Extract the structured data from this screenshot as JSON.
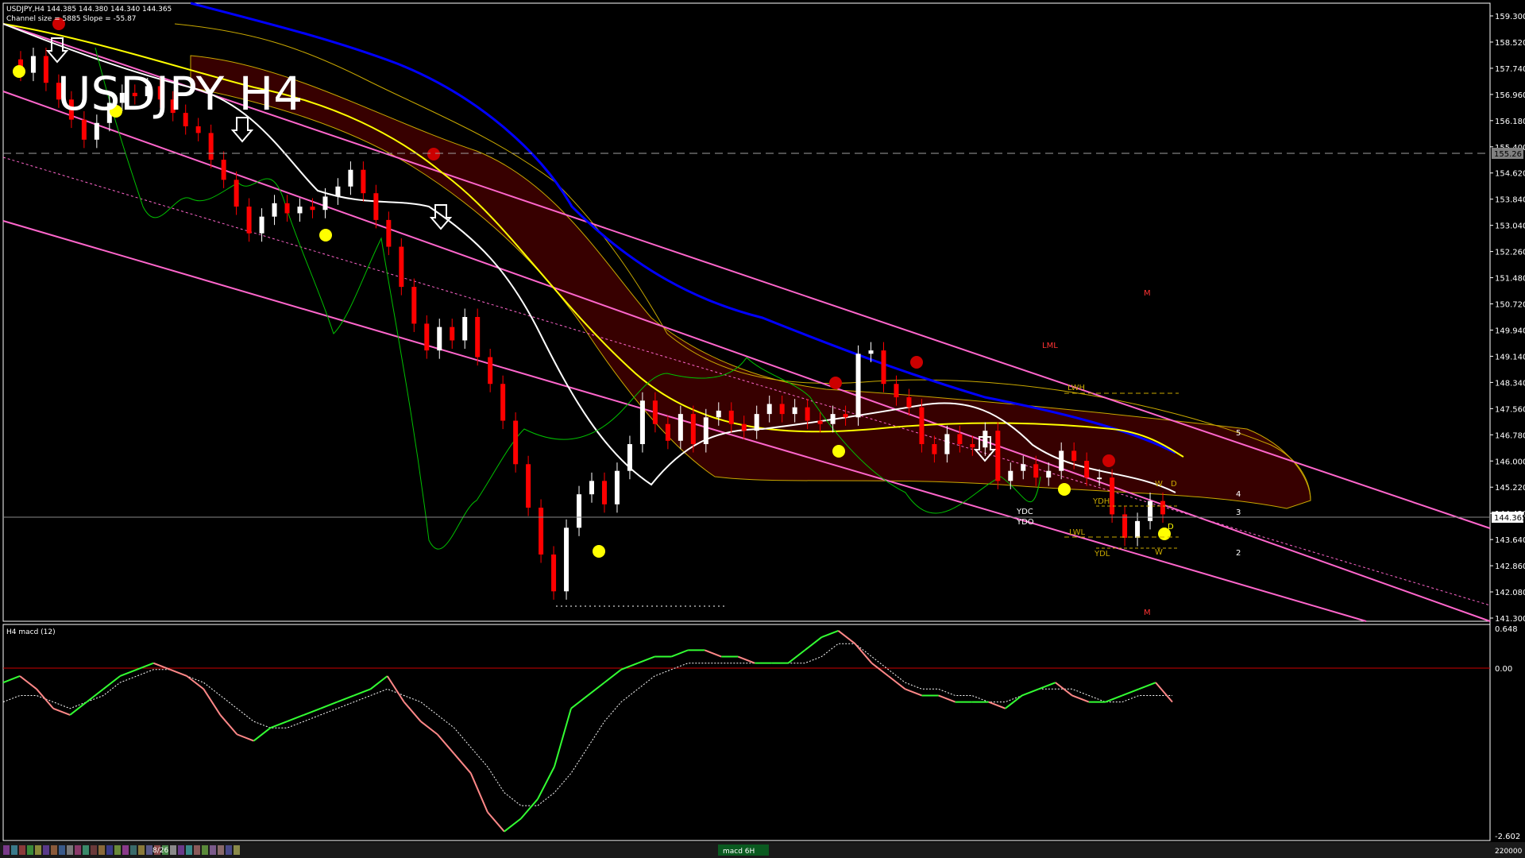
{
  "header": {
    "symbol_info": "USDJPY,H4  144.385 144.380 144.340 144.365",
    "channel_info": "Channel size = 5885 Slope = -55.87",
    "big_title": "USDJPY H4"
  },
  "sub_panel": {
    "label": "H4  macd (12)",
    "axis_labels": [
      "0.648",
      "0.00",
      "-2.602"
    ]
  },
  "price_axis": {
    "labels": [
      "159.300",
      "158.520",
      "157.740",
      "156.960",
      "156.180",
      "155.400",
      "154.620",
      "153.840",
      "153.040",
      "152.260",
      "151.480",
      "150.720",
      "149.940",
      "149.140",
      "148.340",
      "147.560",
      "146.780",
      "146.000",
      "145.220",
      "144.420",
      "143.640",
      "142.860",
      "142.080",
      "141.300"
    ],
    "current_price": "144.365",
    "dashed_level_label": "155.26",
    "macd_volume_label": "220000"
  },
  "level_labels": {
    "lwh": "LWH",
    "lml": "LML",
    "lwl": "LWL",
    "ydh": "YDH",
    "ydl": "YDL",
    "ydc": "YDC",
    "ydo": "YDO",
    "m_top": "M",
    "m_bottom": "M",
    "w_top": "W",
    "d_top": "D",
    "w_bottom": "W",
    "d_bottom": "D",
    "n5": "5",
    "n4": "4",
    "n3": "3",
    "n2": "2"
  },
  "bottom_bar": {
    "date_label": "8/26",
    "tab_label": "macd 6H"
  },
  "colors": {
    "bull_candle": "#ffffff",
    "bear_candle": "#ff0000",
    "ma_blue": "#0000ff",
    "ma_yellow": "#ffff00",
    "ma_white": "#ffffff",
    "channel": "#ff66cc",
    "chikou": "#00c000",
    "cloud_edge": "#c8a800",
    "macd_main_up": "#33ff33",
    "macd_main_down": "#ff8888",
    "signal": "#ffffff"
  },
  "chart_data": [
    {
      "type": "line",
      "title": "USDJPY H4",
      "ylim": [
        141.3,
        159.3
      ],
      "series": [
        {
          "name": "price",
          "values": [
            158.0,
            157.6,
            158.1,
            157.3,
            156.8,
            156.2,
            155.6,
            156.1,
            156.7,
            157.0,
            156.9,
            157.2,
            156.8,
            156.4,
            156.0,
            155.8,
            155.0,
            154.4,
            153.6,
            152.8,
            153.3,
            153.7,
            153.4,
            153.6,
            153.5,
            153.9,
            154.2,
            154.7,
            154.0,
            153.2,
            152.4,
            151.2,
            150.1,
            149.3,
            150.0,
            149.6,
            150.3,
            149.1,
            148.3,
            147.2,
            145.9,
            144.6,
            143.2,
            142.1,
            144.0,
            145.0,
            145.4,
            144.7,
            145.7,
            146.5,
            147.8,
            147.1,
            146.6,
            147.4,
            146.5,
            147.3,
            147.5,
            147.1,
            146.9,
            147.4,
            147.7,
            147.4,
            147.6,
            147.2,
            147.1,
            147.4,
            147.3,
            149.2,
            149.3,
            148.3,
            147.9,
            147.6,
            146.5,
            146.2,
            146.8,
            146.5,
            146.4,
            146.9,
            145.4,
            145.7,
            145.9,
            145.5,
            145.7,
            146.3,
            146.0,
            145.5,
            145.5,
            144.4,
            143.7,
            144.2,
            144.8,
            144.4
          ]
        }
      ]
    },
    {
      "type": "line",
      "title": "H4 macd (12)",
      "ylim": [
        -2.602,
        0.648
      ],
      "series": [
        {
          "name": "macd",
          "values": [
            -0.2,
            -0.1,
            -0.3,
            -0.6,
            -0.7,
            -0.5,
            -0.3,
            -0.1,
            0.0,
            0.1,
            0.0,
            -0.1,
            -0.3,
            -0.7,
            -1.0,
            -1.1,
            -0.9,
            -0.8,
            -0.7,
            -0.6,
            -0.5,
            -0.4,
            -0.3,
            -0.1,
            -0.5,
            -0.8,
            -1.0,
            -1.3,
            -1.6,
            -2.2,
            -2.5,
            -2.3,
            -2.0,
            -1.5,
            -0.6,
            -0.4,
            -0.2,
            0.0,
            0.1,
            0.2,
            0.2,
            0.3,
            0.3,
            0.2,
            0.2,
            0.1,
            0.1,
            0.1,
            0.3,
            0.5,
            0.6,
            0.4,
            0.1,
            -0.1,
            -0.3,
            -0.4,
            -0.4,
            -0.5,
            -0.5,
            -0.5,
            -0.6,
            -0.4,
            -0.3,
            -0.2,
            -0.4,
            -0.5,
            -0.5,
            -0.4,
            -0.3,
            -0.2,
            -0.5
          ]
        },
        {
          "name": "signal",
          "values": [
            -0.5,
            -0.4,
            -0.4,
            -0.5,
            -0.6,
            -0.5,
            -0.4,
            -0.2,
            -0.1,
            0.0,
            0.0,
            -0.1,
            -0.2,
            -0.4,
            -0.6,
            -0.8,
            -0.9,
            -0.9,
            -0.8,
            -0.7,
            -0.6,
            -0.5,
            -0.4,
            -0.3,
            -0.4,
            -0.5,
            -0.7,
            -0.9,
            -1.2,
            -1.5,
            -1.9,
            -2.1,
            -2.1,
            -1.9,
            -1.6,
            -1.2,
            -0.8,
            -0.5,
            -0.3,
            -0.1,
            0.0,
            0.1,
            0.1,
            0.1,
            0.1,
            0.1,
            0.1,
            0.1,
            0.1,
            0.2,
            0.4,
            0.4,
            0.2,
            0.0,
            -0.2,
            -0.3,
            -0.3,
            -0.4,
            -0.4,
            -0.5,
            -0.5,
            -0.4,
            -0.3,
            -0.3,
            -0.3,
            -0.4,
            -0.5,
            -0.5,
            -0.4,
            -0.4,
            -0.4
          ]
        }
      ]
    }
  ]
}
